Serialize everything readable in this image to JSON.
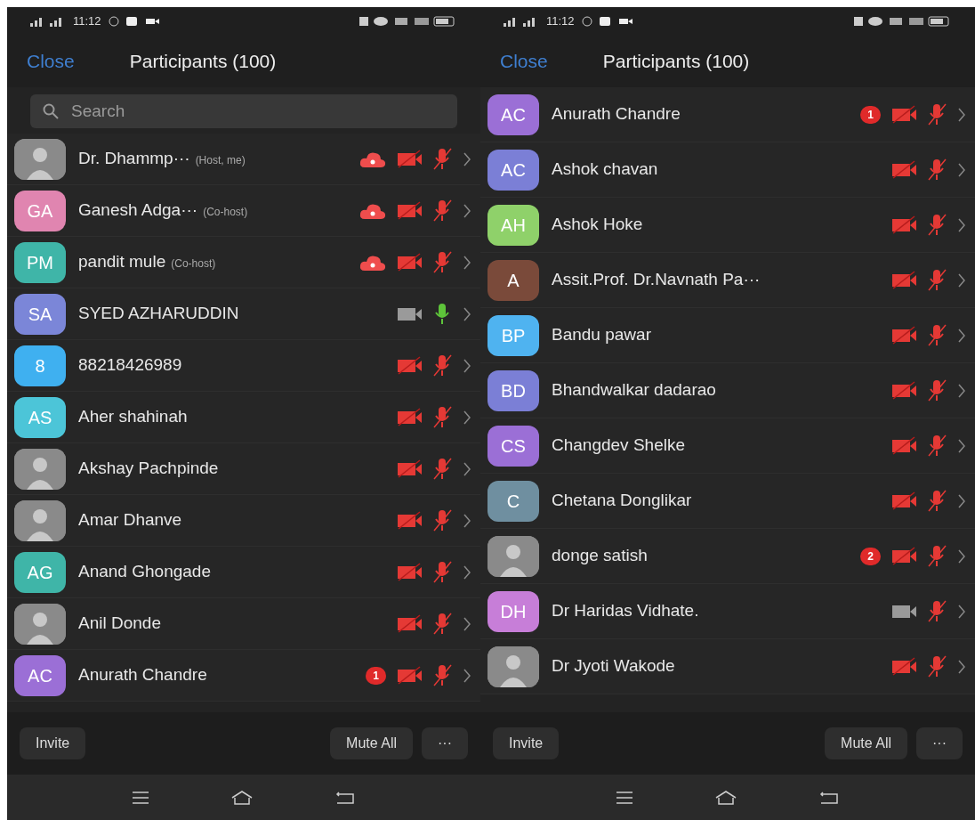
{
  "panels": [
    {
      "status_bar": {
        "time": "11:12"
      },
      "header": {
        "close": "Close",
        "title": "Participants (100)"
      },
      "search": {
        "placeholder": "Search"
      },
      "participants": [
        {
          "name": "Dr. Dhammp···",
          "role": "(Host, me)",
          "avatar": {
            "kind": "photo"
          },
          "recording": true,
          "video_on": false,
          "muted": true
        },
        {
          "name": "Ganesh Adga···",
          "role": "(Co-host)",
          "avatar": {
            "kind": "initials",
            "initials": "GA",
            "color": "#e085b0"
          },
          "recording": true,
          "video_on": false,
          "muted": true
        },
        {
          "name": "pandit mule",
          "role": "(Co-host)",
          "avatar": {
            "kind": "initials",
            "initials": "PM",
            "color": "#3fb5a8"
          },
          "recording": true,
          "video_on": false,
          "muted": true
        },
        {
          "name": "SYED AZHARUDDIN",
          "avatar": {
            "kind": "initials",
            "initials": "SA",
            "color": "#7b86d8"
          },
          "recording": false,
          "video_on": true,
          "muted": false
        },
        {
          "name": "88218426989",
          "avatar": {
            "kind": "initials",
            "initials": "8",
            "color": "#3fb0f0"
          },
          "recording": false,
          "video_on": false,
          "muted": true
        },
        {
          "name": "Aher shahinah",
          "avatar": {
            "kind": "initials",
            "initials": "AS",
            "color": "#4cc5d8"
          },
          "recording": false,
          "video_on": false,
          "muted": true
        },
        {
          "name": "Akshay Pachpinde",
          "avatar": {
            "kind": "photo"
          },
          "recording": false,
          "video_on": false,
          "muted": true
        },
        {
          "name": "Amar Dhanve",
          "avatar": {
            "kind": "photo"
          },
          "recording": false,
          "video_on": false,
          "muted": true
        },
        {
          "name": "Anand Ghongade",
          "avatar": {
            "kind": "initials",
            "initials": "AG",
            "color": "#3fb5a8"
          },
          "recording": false,
          "video_on": false,
          "muted": true
        },
        {
          "name": "Anil Donde",
          "avatar": {
            "kind": "photo"
          },
          "recording": false,
          "video_on": false,
          "muted": true
        },
        {
          "name": "Anurath Chandre",
          "avatar": {
            "kind": "initials",
            "initials": "AC",
            "color": "#9b6fd6"
          },
          "badge": "1",
          "recording": false,
          "video_on": false,
          "muted": true
        }
      ],
      "footer": {
        "invite": "Invite",
        "mute_all": "Mute All",
        "more": "···"
      }
    },
    {
      "status_bar": {
        "time": "11:12"
      },
      "header": {
        "close": "Close",
        "title": "Participants (100)"
      },
      "participants": [
        {
          "name": "Anurath Chandre",
          "avatar": {
            "kind": "initials",
            "initials": "AC",
            "color": "#9b6fd6"
          },
          "badge": "1",
          "recording": false,
          "video_on": false,
          "muted": true
        },
        {
          "name": "Ashok chavan",
          "avatar": {
            "kind": "initials",
            "initials": "AC",
            "color": "#7b7fd6"
          },
          "recording": false,
          "video_on": false,
          "muted": true
        },
        {
          "name": "Ashok Hoke",
          "avatar": {
            "kind": "initials",
            "initials": "AH",
            "color": "#8fd16a"
          },
          "recording": false,
          "video_on": false,
          "muted": true
        },
        {
          "name": "Assit.Prof. Dr.Navnath Pa···",
          "avatar": {
            "kind": "initials",
            "initials": "A",
            "color": "#7a4a3a"
          },
          "recording": false,
          "video_on": false,
          "muted": true
        },
        {
          "name": "Bandu pawar",
          "avatar": {
            "kind": "initials",
            "initials": "BP",
            "color": "#4fb3f0"
          },
          "recording": false,
          "video_on": false,
          "muted": true
        },
        {
          "name": "Bhandwalkar dadarao",
          "avatar": {
            "kind": "initials",
            "initials": "BD",
            "color": "#7b7fd6"
          },
          "recording": false,
          "video_on": false,
          "muted": true
        },
        {
          "name": "Changdev Shelke",
          "avatar": {
            "kind": "initials",
            "initials": "CS",
            "color": "#9b6fd6"
          },
          "recording": false,
          "video_on": false,
          "muted": true
        },
        {
          "name": "Chetana Donglikar",
          "avatar": {
            "kind": "initials",
            "initials": "C",
            "color": "#6f8fa0"
          },
          "recording": false,
          "video_on": false,
          "muted": true
        },
        {
          "name": "donge satish",
          "avatar": {
            "kind": "photo"
          },
          "badge": "2",
          "recording": false,
          "video_on": false,
          "muted": true
        },
        {
          "name": "Dr Haridas Vidhate.",
          "avatar": {
            "kind": "initials",
            "initials": "DH",
            "color": "#c77ed8"
          },
          "recording": false,
          "video_on": true,
          "muted": true
        },
        {
          "name": "Dr Jyoti Wakode",
          "avatar": {
            "kind": "photo"
          },
          "recording": false,
          "video_on": false,
          "muted": true
        }
      ],
      "footer": {
        "invite": "Invite",
        "mute_all": "Mute All",
        "more": "···"
      }
    }
  ]
}
